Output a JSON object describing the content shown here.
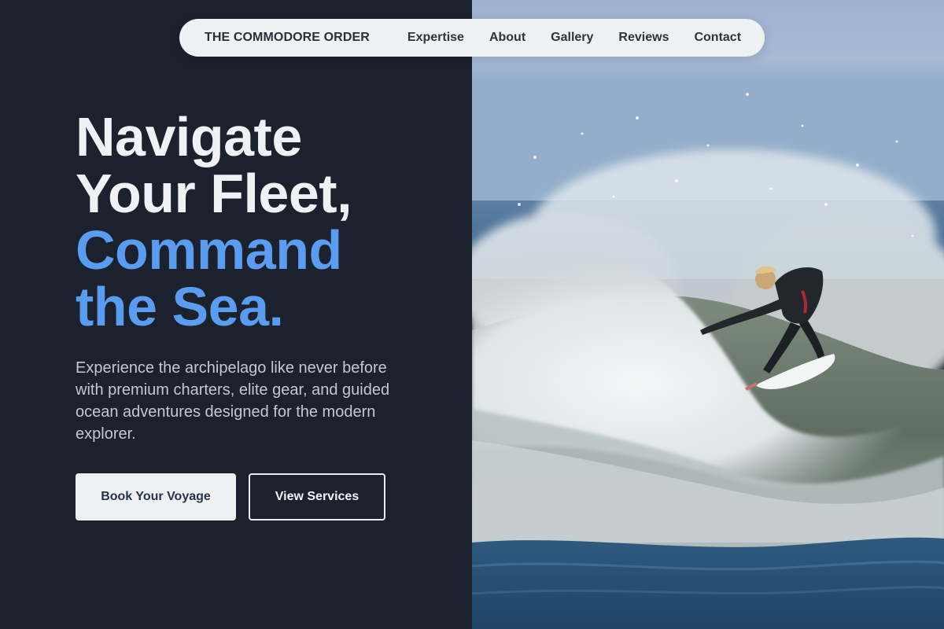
{
  "nav": {
    "brand": "THE COMMODORE ORDER",
    "links": [
      "Expertise",
      "About",
      "Gallery",
      "Reviews",
      "Contact"
    ]
  },
  "hero": {
    "headline_line1": "Navigate",
    "headline_line2": "Your Fleet,",
    "headline_accent_line1": "Command",
    "headline_accent_line2": "the Sea.",
    "description": "Experience the archipelago like never before with premium charters, elite gear, and guided ocean adventures designed for the modern explorer.",
    "primary_button": "Book Your Voyage",
    "secondary_button": "View Services",
    "image_alt": "Surfer riding a breaking wave with spray"
  },
  "colors": {
    "background": "#1b222d",
    "accent": "#5a9cf0",
    "nav_background": "#edf1f2",
    "text_light": "#eef2f4",
    "text_muted": "#c3c9cf"
  }
}
